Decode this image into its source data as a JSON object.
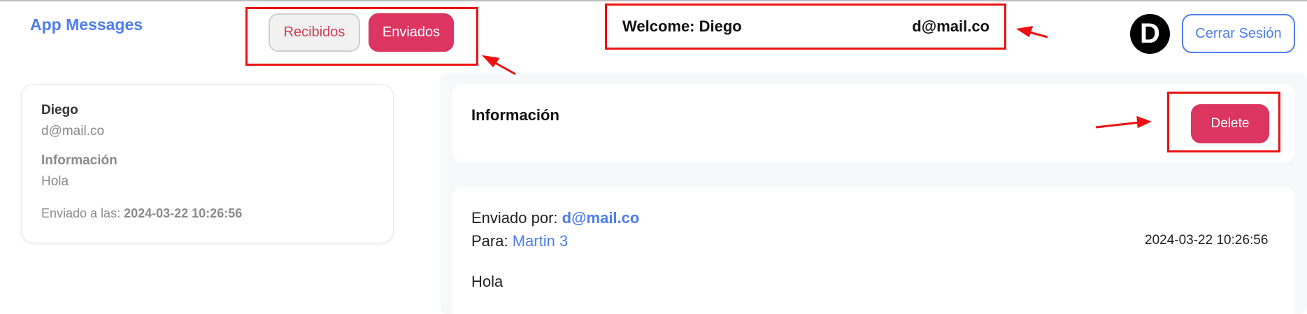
{
  "app": {
    "title": "App Messages"
  },
  "tabs": [
    {
      "label": "Recibidos",
      "active": false
    },
    {
      "label": "Enviados",
      "active": true
    }
  ],
  "welcome": {
    "label": "Welcome: Diego",
    "email": "d@mail.co"
  },
  "avatar": {
    "initial": "D"
  },
  "logout": {
    "label": "Cerrar Sesión"
  },
  "message_list": [
    {
      "name": "Diego",
      "email": "d@mail.co",
      "subject": "Información",
      "body": "Hola",
      "sent_label": "Enviado a las:",
      "sent_at": "2024-03-22 10:26:56"
    }
  ],
  "detail": {
    "title": "Información",
    "delete_label": "Delete",
    "sent_by_label": "Enviado por:",
    "sent_by": "d@mail.co",
    "to_label": "Para:",
    "to": "Martin 3",
    "date": "2024-03-22 10:26:56",
    "body": "Hola"
  },
  "colors": {
    "accent_blue": "#4f7ef0",
    "accent_pink": "#dc3562",
    "annotation_red": "#ee1111"
  }
}
